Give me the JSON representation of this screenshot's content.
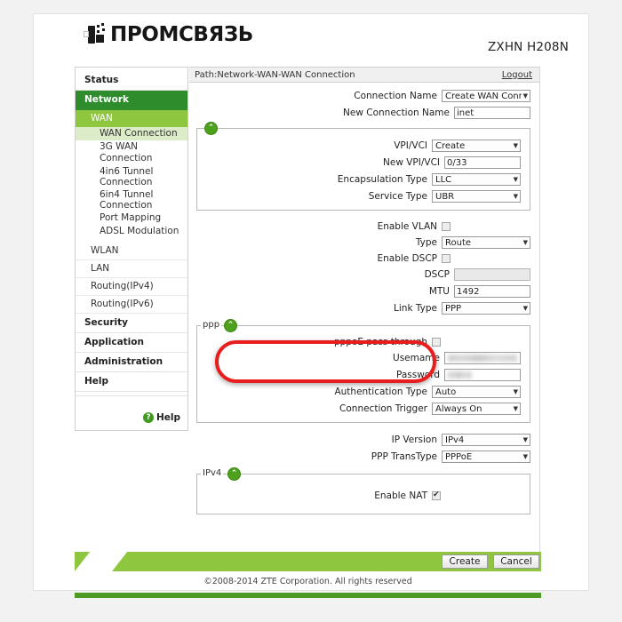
{
  "brand": {
    "logo_text": "ПРОМСВЯЗЬ",
    "logo_icon": "promsvyaz-logo-icon",
    "model": "ZXHN H208N"
  },
  "sidebar": {
    "items": [
      {
        "label": "Status",
        "level": "group",
        "state": "normal"
      },
      {
        "label": "Network",
        "level": "group",
        "state": "active"
      },
      {
        "label": "WAN",
        "level": "sub",
        "state": "open"
      },
      {
        "label": "WAN Connection",
        "level": "leaf",
        "state": "selected"
      },
      {
        "label": "3G WAN Connection",
        "level": "leaf",
        "state": "normal"
      },
      {
        "label": "4in6 Tunnel Connection",
        "level": "leaf",
        "state": "normal"
      },
      {
        "label": "6in4 Tunnel Connection",
        "level": "leaf",
        "state": "normal"
      },
      {
        "label": "Port Mapping",
        "level": "leaf",
        "state": "normal"
      },
      {
        "label": "ADSL Modulation",
        "level": "leaf",
        "state": "normal"
      },
      {
        "label": "WLAN",
        "level": "sub",
        "state": "normal"
      },
      {
        "label": "LAN",
        "level": "sub",
        "state": "normal"
      },
      {
        "label": "Routing(IPv4)",
        "level": "sub",
        "state": "normal"
      },
      {
        "label": "Routing(IPv6)",
        "level": "sub",
        "state": "normal"
      },
      {
        "label": "Security",
        "level": "group",
        "state": "normal"
      },
      {
        "label": "Application",
        "level": "group",
        "state": "normal"
      },
      {
        "label": "Administration",
        "level": "group",
        "state": "normal"
      },
      {
        "label": "Help",
        "level": "group",
        "state": "normal"
      }
    ],
    "help": {
      "icon": "question-mark-icon",
      "label": "Help"
    }
  },
  "pathbar": {
    "path": "Path:Network-WAN-WAN Connection",
    "logout": "Logout"
  },
  "form": {
    "connection_name": {
      "label": "Connection Name",
      "value": "Create WAN Conne"
    },
    "new_connection_name": {
      "label": "New Connection Name",
      "value": "inet"
    },
    "atm_group": {
      "toggle_icon": "collapse-up-icon",
      "vpi_vci": {
        "label": "VPI/VCI",
        "value": "Create"
      },
      "new_vpi_vci": {
        "label": "New VPI/VCI",
        "value": "0/33"
      },
      "encapsulation_type": {
        "label": "Encapsulation Type",
        "value": "LLC"
      },
      "service_type": {
        "label": "Service Type",
        "value": "UBR"
      }
    },
    "enable_vlan": {
      "label": "Enable VLAN",
      "checked": false
    },
    "type": {
      "label": "Type",
      "value": "Route"
    },
    "enable_dscp": {
      "label": "Enable DSCP",
      "checked": false
    },
    "dscp": {
      "label": "DSCP",
      "value": "",
      "disabled": true
    },
    "mtu": {
      "label": "MTU",
      "value": "1492"
    },
    "link_type": {
      "label": "Link Type",
      "value": "PPP"
    },
    "ppp_group": {
      "legend": "ppp",
      "toggle_icon": "collapse-up-icon",
      "pppoe_pass_through": {
        "label": "pppoE pass through",
        "checked": false
      },
      "username": {
        "label": "Usemame",
        "value": "",
        "masked": true
      },
      "password": {
        "label": "Password",
        "value": "",
        "masked": true
      },
      "authentication_type": {
        "label": "Authentication Type",
        "value": "Auto"
      },
      "connection_trigger": {
        "label": "Connection Trigger",
        "value": "Always On"
      }
    },
    "ip_version": {
      "label": "IP Version",
      "value": "IPv4"
    },
    "ppp_transtype": {
      "label": "PPP TransType",
      "value": "PPPoE"
    },
    "ipv4_group": {
      "legend": "IPv4",
      "toggle_icon": "collapse-up-icon",
      "enable_nat": {
        "label": "Enable NAT",
        "checked": true
      }
    }
  },
  "footer": {
    "create_button": "Create",
    "cancel_button": "Cancel",
    "copyright": "©2008-2014 ZTE Corporation. All rights reserved"
  },
  "annotation": {
    "highlight_color": "#e81d1d",
    "target": "username-password-fields"
  },
  "colors": {
    "green_dark": "#2f8c2c",
    "green_mid": "#8ec63f",
    "green_light": "#dcecc8",
    "green_bar": "#4d9b25"
  }
}
